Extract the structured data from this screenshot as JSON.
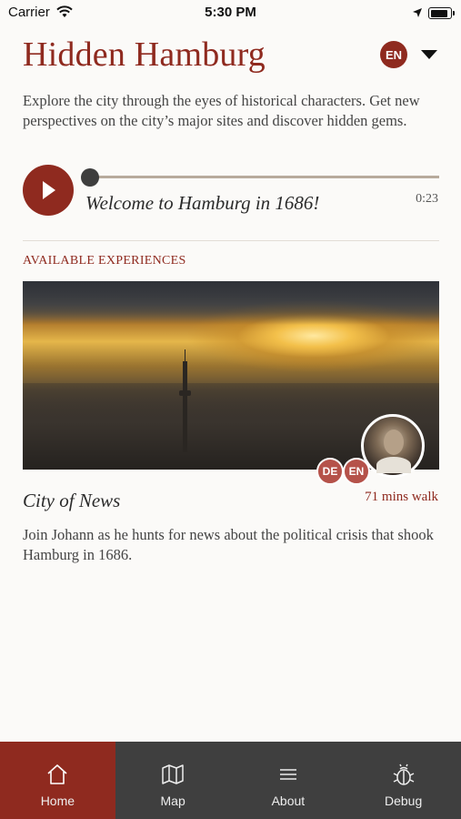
{
  "status_bar": {
    "carrier": "Carrier",
    "time": "5:30 PM"
  },
  "header": {
    "title": "Hidden Hamburg",
    "language": "EN"
  },
  "intro": "Explore the city through the eyes of historical characters. Get new perspectives on the city’s major sites and discover hidden gems.",
  "player": {
    "track_title": "Welcome to Hamburg in 1686!",
    "duration": "0:23",
    "progress": 0
  },
  "section_label": "AVAILABLE EXPERIENCES",
  "experience": {
    "title": "City of News",
    "walk": "71 mins walk",
    "languages": [
      "DE",
      "EN"
    ],
    "description": "Join Johann as he hunts for news about the political crisis that shook Hamburg in 1686."
  },
  "tabs": [
    {
      "label": "Home",
      "icon": "home-icon",
      "active": true
    },
    {
      "label": "Map",
      "icon": "map-icon",
      "active": false
    },
    {
      "label": "About",
      "icon": "menu-icon",
      "active": false
    },
    {
      "label": "Debug",
      "icon": "bug-icon",
      "active": false
    }
  ],
  "colors": {
    "accent": "#8f2a1f",
    "tabbar": "#3f3f3f",
    "chip": "#b5524a"
  }
}
